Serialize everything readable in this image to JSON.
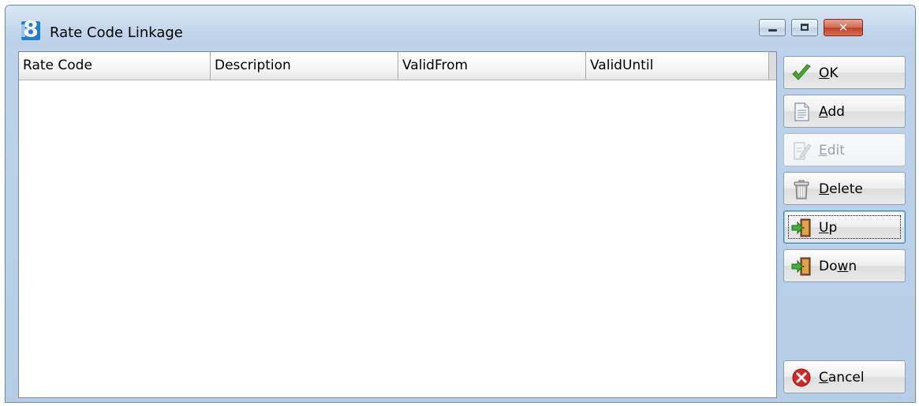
{
  "window": {
    "title": "Rate Code Linkage",
    "app_icon_glyph": "8",
    "controls": [
      "minimize",
      "maximize",
      "close"
    ]
  },
  "grid": {
    "columns": [
      "Rate Code",
      "Description",
      "ValidFrom",
      "ValidUntil"
    ],
    "rows": []
  },
  "buttons": {
    "ok": {
      "mnemonic": "O",
      "rest": "K",
      "icon": "checkmark-icon",
      "color": "#4aa831"
    },
    "add": {
      "mnemonic": "A",
      "rest": "dd",
      "icon": "document-icon"
    },
    "edit": {
      "mnemonic": "E",
      "rest": "dit",
      "icon": "edit-document-icon",
      "disabled": true
    },
    "delete": {
      "mnemonic": "D",
      "rest": "elete",
      "icon": "trash-icon"
    },
    "up": {
      "mnemonic": "U",
      "rest": "p",
      "icon": "door-arrow-icon",
      "focused": true
    },
    "down": {
      "pre": "Do",
      "mnemonic": "w",
      "rest": "n",
      "icon": "door-arrow-icon"
    },
    "cancel": {
      "mnemonic": "C",
      "rest": "ancel",
      "icon": "cancel-x-icon",
      "color": "#d7262a"
    }
  }
}
